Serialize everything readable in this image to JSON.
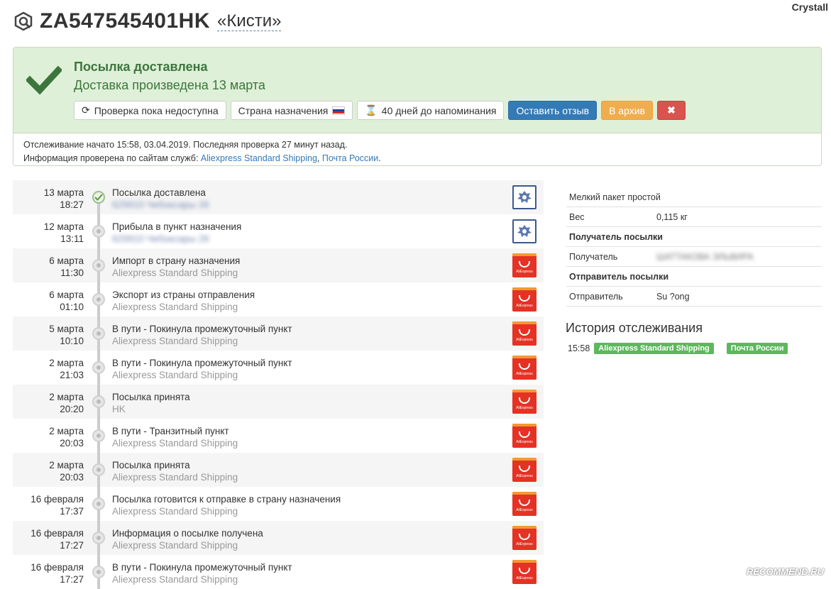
{
  "watermark_top": "Crystall",
  "header": {
    "tracking_number": "ZA547545401HK",
    "parcel_name": "«Кисти»"
  },
  "status": {
    "title": "Посылка доставлена",
    "subtitle": "Доставка произведена 13 марта",
    "actions": {
      "refresh_label": "Проверка пока недоступна",
      "country_label": "Страна назначения",
      "reminder_label": "40 дней до напоминания",
      "review_label": "Оставить отзыв",
      "archive_label": "В архив",
      "delete_label": "✖"
    },
    "info_line1": "Отслеживание начато 15:58, 03.04.2019. Последняя проверка 27 минут назад.",
    "info_prefix": "Информация проверена по сайтам служб:",
    "service_links": [
      "Aliexpress Standard Shipping",
      "Почта России"
    ]
  },
  "events": [
    {
      "day": "13 марта",
      "time": "18:27",
      "title": "Посылка доставлена",
      "sub": "629910 Чебоксары 26",
      "service": "post",
      "done": true
    },
    {
      "day": "12 марта",
      "time": "13:11",
      "title": "Прибыла в пункт назначения",
      "sub": "629910 Чебоксары 26",
      "service": "post"
    },
    {
      "day": "6 марта",
      "time": "11:30",
      "title": "Импорт в страну назначения",
      "sub": "Aliexpress Standard Shipping",
      "service": "aliexpress"
    },
    {
      "day": "6 марта",
      "time": "01:10",
      "title": "Экспорт из страны отправления",
      "sub": "Aliexpress Standard Shipping",
      "service": "aliexpress"
    },
    {
      "day": "5 марта",
      "time": "10:10",
      "title": "В пути - Покинула промежуточный пункт",
      "sub": "Aliexpress Standard Shipping",
      "service": "aliexpress"
    },
    {
      "day": "2 марта",
      "time": "21:03",
      "title": "В пути - Покинула промежуточный пункт",
      "sub": "Aliexpress Standard Shipping",
      "service": "aliexpress"
    },
    {
      "day": "2 марта",
      "time": "20:20",
      "title": "Посылка принята",
      "sub": "HK",
      "service": "aliexpress"
    },
    {
      "day": "2 марта",
      "time": "20:03",
      "title": "В пути - Транзитный пункт",
      "sub": "Aliexpress Standard Shipping",
      "service": "aliexpress"
    },
    {
      "day": "2 марта",
      "time": "20:03",
      "title": "Посылка принята",
      "sub": "Aliexpress Standard Shipping",
      "service": "aliexpress"
    },
    {
      "day": "16 февраля",
      "time": "17:37",
      "title": "Посылка готовится к отправке в страну назначения",
      "sub": "Aliexpress Standard Shipping",
      "service": "aliexpress"
    },
    {
      "day": "16 февраля",
      "time": "17:27",
      "title": "Информация о посылке получена",
      "sub": "Aliexpress Standard Shipping",
      "service": "aliexpress"
    },
    {
      "day": "16 февраля",
      "time": "17:27",
      "title": "В пути - Покинула промежуточный пункт",
      "sub": "Aliexpress Standard Shipping",
      "service": "aliexpress"
    }
  ],
  "aliexpress_badge_text": "AliExpress",
  "details": {
    "package_type": "Мелкий пакет простой",
    "weight_label": "Вес",
    "weight_value": "0,115 кг",
    "recipient_header": "Получатель посылки",
    "recipient_label": "Получатель",
    "recipient_value": "ШАТТАКОВА ЭЛЬВИРА",
    "sender_header": "Отправитель посылки",
    "sender_label": "Отправитель",
    "sender_value": "Su ?ong"
  },
  "history": {
    "title": "История отслеживания",
    "time": "15:58",
    "tags": [
      "Aliexpress Standard Shipping",
      "Почта России"
    ]
  },
  "recommend_mark": "RECOMMEND.RU",
  "colors": {
    "success": "#3c763d",
    "primary": "#337ab7",
    "warning": "#f0ad4e",
    "danger": "#d9534f",
    "tag_green": "#5cb85c"
  }
}
